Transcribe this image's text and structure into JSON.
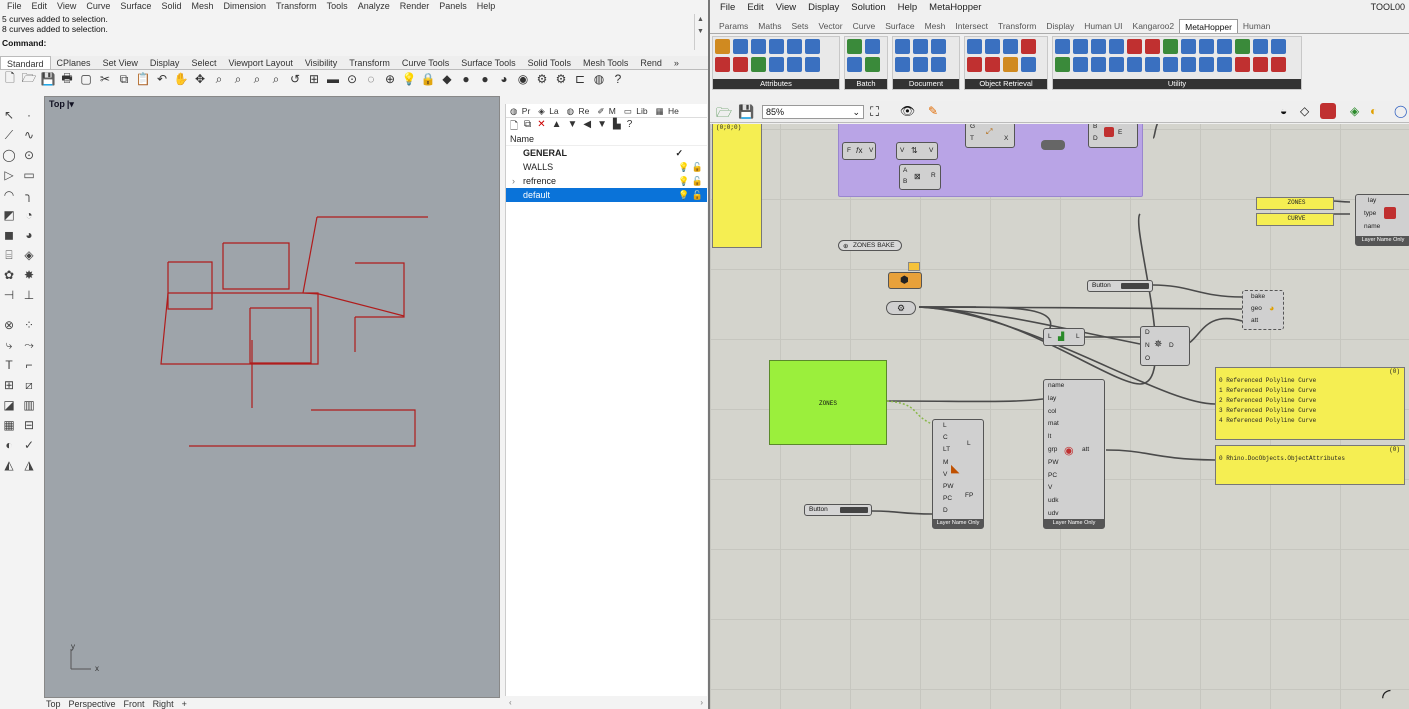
{
  "rhino": {
    "menu": [
      "File",
      "Edit",
      "View",
      "Curve",
      "Surface",
      "Solid",
      "Mesh",
      "Dimension",
      "Transform",
      "Tools",
      "Analyze",
      "Render",
      "Panels",
      "Help"
    ],
    "history": [
      "5 curves added to selection.",
      "8 curves added to selection."
    ],
    "command_label": "Command:",
    "toolbar_tabs": [
      "Standard",
      "CPlanes",
      "Set View",
      "Display",
      "Select",
      "Viewport Layout",
      "Visibility",
      "Transform",
      "Curve Tools",
      "Surface Tools",
      "Solid Tools",
      "Mesh Tools",
      "Rend"
    ],
    "toolbar_more": "»",
    "viewport_title": "Top",
    "viewport_tabs": [
      "Top",
      "Perspective",
      "Front",
      "Right"
    ],
    "viewport_tabs_add": "+",
    "axis_x": "x",
    "axis_y": "y",
    "panel_tabs": [
      "Pr",
      "La",
      "Re",
      "M",
      "Lib",
      "He"
    ],
    "layers_header": "Name",
    "layers": [
      {
        "name": "GENERAL",
        "bold": true,
        "mark": "✓"
      },
      {
        "name": "WALLS",
        "bold": false,
        "mark": ""
      },
      {
        "name": "refrence",
        "bold": false,
        "mark": "",
        "expandable": true
      },
      {
        "name": "default",
        "bold": false,
        "mark": "",
        "selected": true
      }
    ],
    "curve_color": "#b01c1c"
  },
  "gh": {
    "menu": [
      "File",
      "Edit",
      "View",
      "Display",
      "Solution",
      "Help",
      "MetaHopper"
    ],
    "title": "TOOL00",
    "tabs": [
      "Params",
      "Maths",
      "Sets",
      "Vector",
      "Curve",
      "Surface",
      "Mesh",
      "Intersect",
      "Transform",
      "Display",
      "Human UI",
      "Kangaroo2",
      "MetaHopper",
      "Human"
    ],
    "active_tab": "MetaHopper",
    "ribbon_groups": [
      "Attributes",
      "Batch",
      "Document",
      "Object Retrieval",
      "Utility"
    ],
    "zoom": "85%",
    "components": {
      "zones_bake": "ZONES BAKE",
      "zones_panel": "ZONES",
      "curve_panel": "CURVE",
      "big_green": "ZONES",
      "button1": "Button",
      "button2": "Button",
      "bake_inputs": [
        "bake",
        "geo",
        "att"
      ],
      "layer_inputs": [
        "lay",
        "type",
        "name"
      ],
      "layer_footer": "Layer Name Only",
      "attr_inputs": [
        "name",
        "lay",
        "col",
        "mat",
        "lt",
        "grp",
        "PW",
        "PC",
        "V",
        "udk",
        "udv"
      ],
      "attr_output": "att",
      "attr_footer": "Layer Name Only",
      "lm_inputs": [
        "L",
        "C",
        "LT",
        "M",
        "V",
        "PW",
        "PC",
        "D"
      ],
      "lm_outputs": [
        "L",
        "FP"
      ],
      "lm_footer": "Layer Name Only",
      "dispatch_inputs": [
        "D",
        "N",
        "O"
      ],
      "dispatch_output": "D",
      "purple_pins": [
        "F",
        "V",
        "V",
        "V",
        "A",
        "B",
        "R",
        "G",
        "T",
        "X",
        "B",
        "D",
        "E"
      ],
      "origin_label": "(0;0;0)"
    },
    "panel_curves_index": "(0)",
    "panel_curves": [
      "0 Referenced Polyline Curve",
      "1 Referenced Polyline Curve",
      "2 Referenced Polyline Curve",
      "3 Referenced Polyline Curve",
      "4 Referenced Polyline Curve"
    ],
    "panel_attr_index": "(0)",
    "panel_attr": [
      "0 Rhino.DocObjects.ObjectAttributes"
    ],
    "colors": {
      "yellow": "#f5ee52",
      "green": "#9bef3c",
      "purple": "#b9a4e6"
    }
  }
}
